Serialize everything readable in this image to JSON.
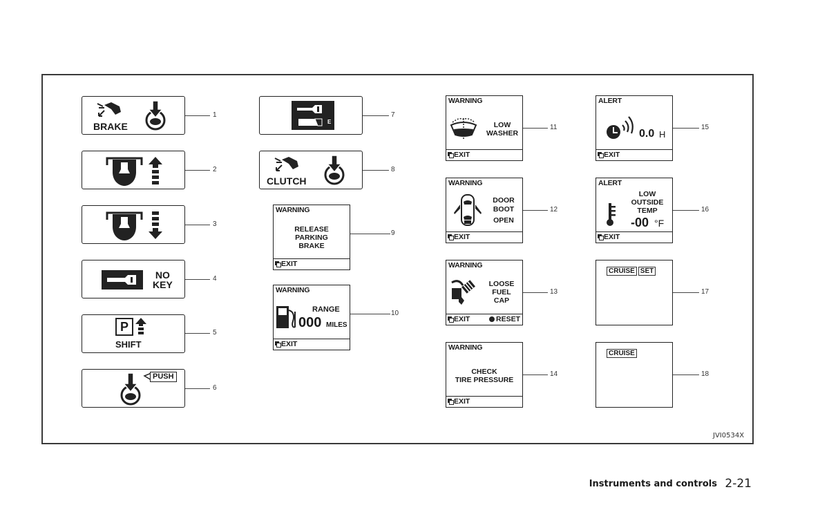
{
  "page": {
    "section_title": "Instruments and controls",
    "page_number": "2-21",
    "figure_ref": "JVI0534X"
  },
  "indicators": [
    {
      "id": "1",
      "label": "BRAKE",
      "icons": [
        "brake-pedal-hand-icon",
        "push-button-icon"
      ]
    },
    {
      "id": "2",
      "icons": [
        "steering-lock-icon",
        "arrow-up-icon"
      ]
    },
    {
      "id": "3",
      "icons": [
        "steering-lock-icon",
        "arrow-down-icon"
      ]
    },
    {
      "id": "4",
      "label_line1": "NO",
      "label_line2": "KEY",
      "icons": [
        "key-icon"
      ]
    },
    {
      "id": "5",
      "p_letter": "P",
      "label": "SHIFT",
      "icons": [
        "arrow-up-icon"
      ]
    },
    {
      "id": "6",
      "bubble": "PUSH",
      "icons": [
        "push-button-icon"
      ]
    },
    {
      "id": "7",
      "e_letter": "E",
      "icons": [
        "key-battery-icon"
      ]
    },
    {
      "id": "8",
      "label": "CLUTCH",
      "icons": [
        "clutch-pedal-hand-icon",
        "push-button-icon"
      ]
    }
  ],
  "screens": [
    {
      "id": "9",
      "header": "WARNING",
      "lines": [
        "RELEASE",
        "PARKING",
        "BRAKE"
      ],
      "exit": "EXIT"
    },
    {
      "id": "10",
      "header": "WARNING",
      "range_label": "RANGE",
      "value": "000",
      "unit": "MILES",
      "exit": "EXIT"
    },
    {
      "id": "11",
      "header": "WARNING",
      "lines": [
        "LOW",
        "WASHER"
      ],
      "exit": "EXIT"
    },
    {
      "id": "12",
      "header": "WARNING",
      "lines": [
        "DOOR",
        "BOOT",
        "OPEN"
      ],
      "exit": "EXIT"
    },
    {
      "id": "13",
      "header": "WARNING",
      "lines": [
        "LOOSE",
        "FUEL",
        "CAP"
      ],
      "exit": "EXIT",
      "reset": "RESET"
    },
    {
      "id": "14",
      "header": "WARNING",
      "lines": [
        "CHECK",
        "TIRE PRESSURE"
      ],
      "exit": "EXIT"
    },
    {
      "id": "15",
      "header": "ALERT",
      "value": "0.0",
      "unit": "H",
      "exit": "EXIT"
    },
    {
      "id": "16",
      "header": "ALERT",
      "lines": [
        "LOW",
        "OUTSIDE",
        "TEMP"
      ],
      "value": "-00",
      "unit": "°F",
      "exit": "EXIT"
    },
    {
      "id": "17",
      "tags": [
        "CRUISE",
        "SET"
      ]
    },
    {
      "id": "18",
      "tags": [
        "CRUISE"
      ]
    }
  ]
}
